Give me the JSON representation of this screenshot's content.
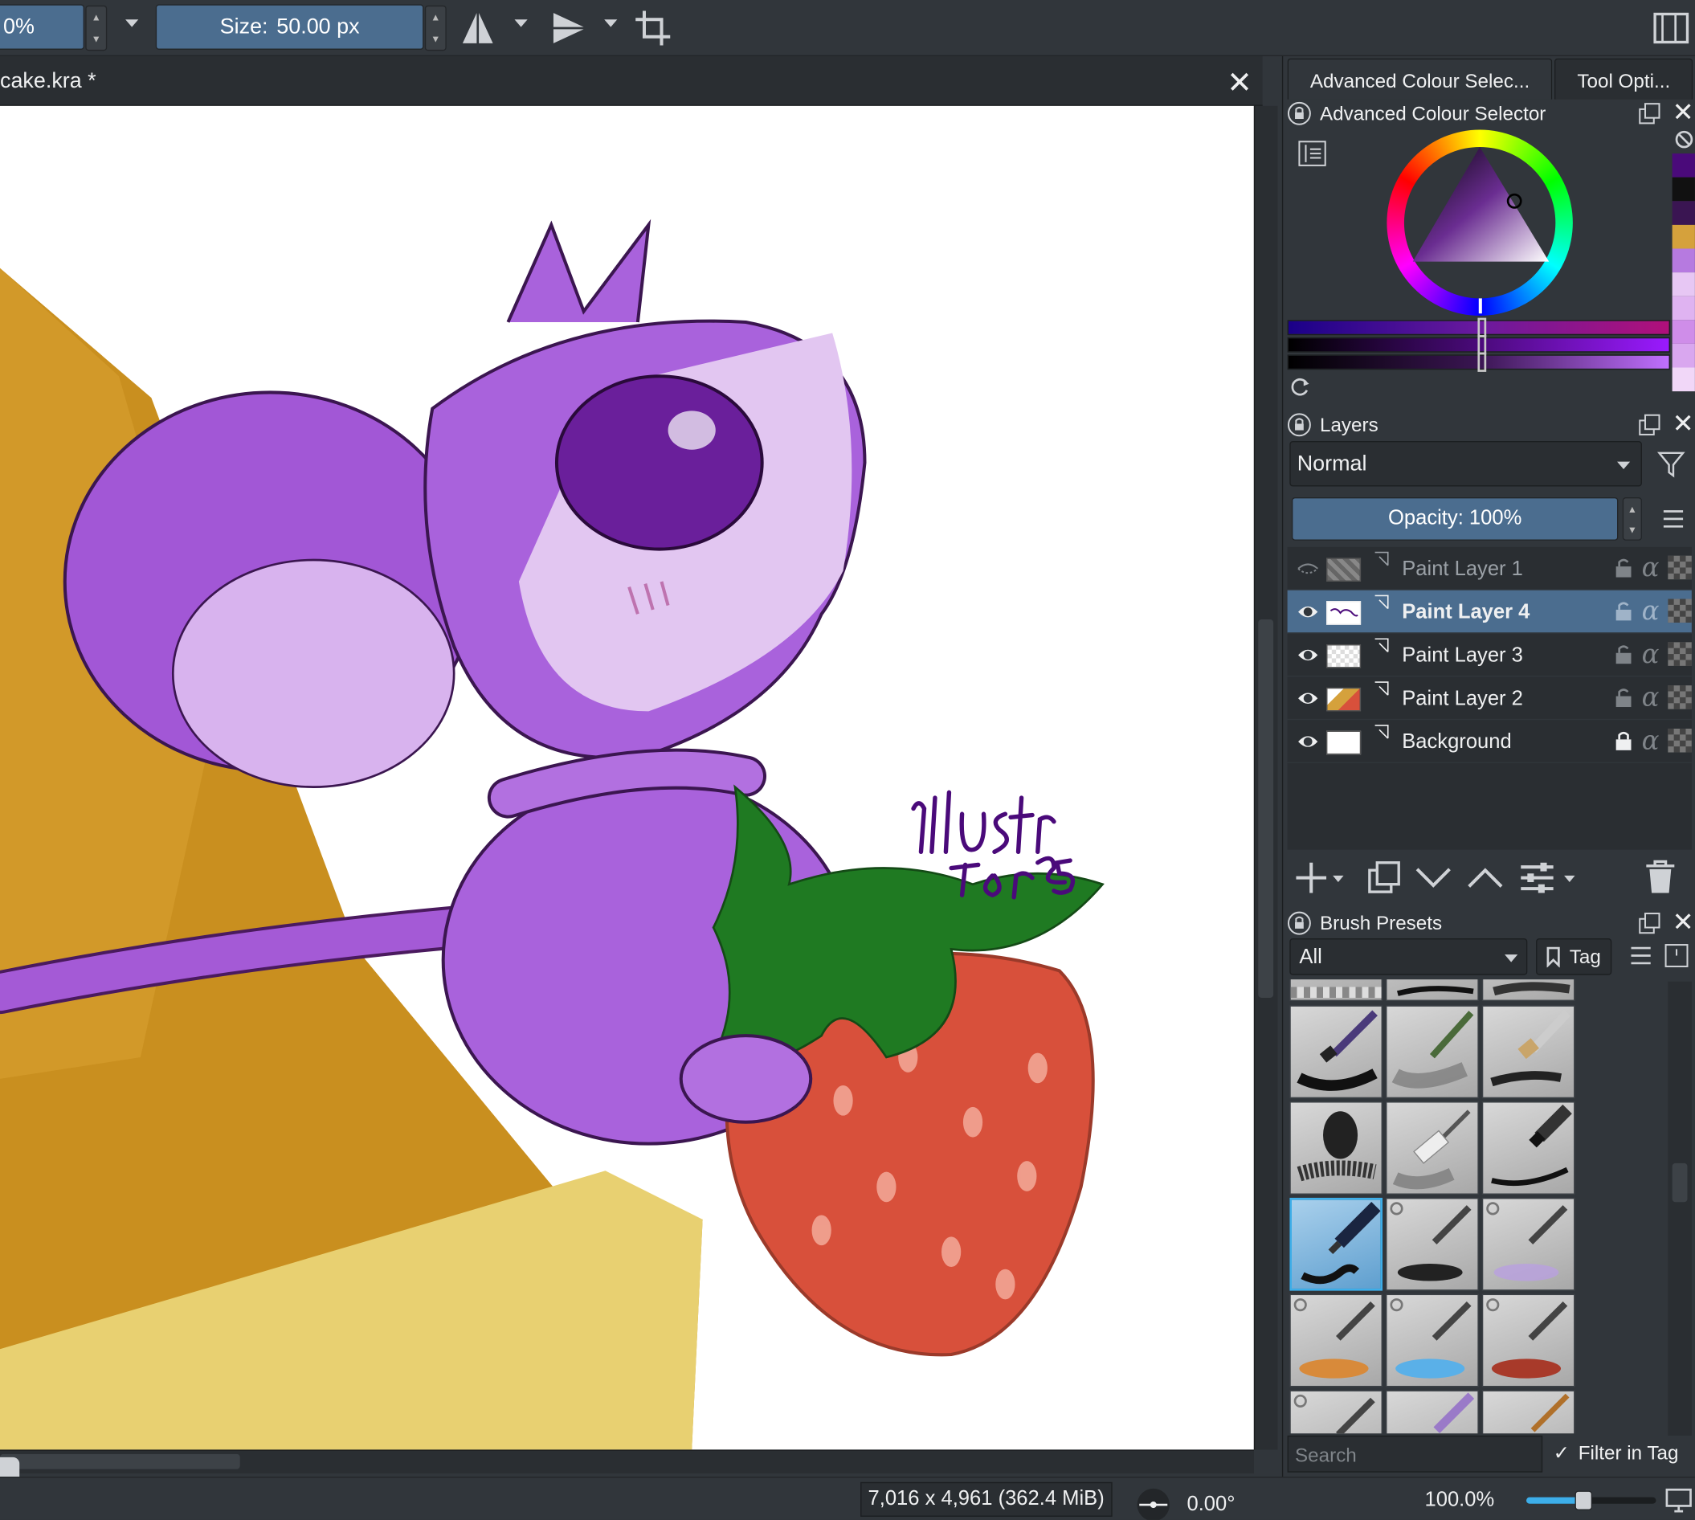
{
  "toolbar": {
    "opacity_value": "0%",
    "size_label": "Size:",
    "size_value": "50.00 px"
  },
  "document": {
    "tab_title": "cake.kra *",
    "signature": "illustrate Tor25"
  },
  "docker": {
    "tabs": [
      "Advanced Colour Selec...",
      "Tool Opti..."
    ],
    "colour_selector_title": "Advanced Colour Selector",
    "palette": [
      "#4a0a7a",
      "#111111",
      "#3a1552",
      "#d5a13c",
      "#b67ae0",
      "#e7c7f4",
      "#dfb3f1",
      "#cf8de9",
      "#d9a7ef",
      "#f1d7f8"
    ],
    "accent": "#4b6d8f"
  },
  "layers": {
    "title": "Layers",
    "blend_mode": "Normal",
    "opacity_label": "Opacity:",
    "opacity_value": "100%",
    "items": [
      {
        "name": "Paint Layer 1",
        "visible": false,
        "selected": false
      },
      {
        "name": "Paint Layer 4",
        "visible": true,
        "selected": true
      },
      {
        "name": "Paint Layer 3",
        "visible": true,
        "selected": false
      },
      {
        "name": "Paint Layer 2",
        "visible": true,
        "selected": false
      },
      {
        "name": "Background",
        "visible": true,
        "selected": false
      }
    ]
  },
  "brush_presets": {
    "title": "Brush Presets",
    "filter_value": "All",
    "tag_label": "Tag",
    "search_placeholder": "Search",
    "filter_in_tag_label": "Filter in Tag"
  },
  "status": {
    "dimensions": "7,016 x 4,961 (362.4 MiB)",
    "rotation": "0.00°",
    "zoom": "100.0%"
  }
}
